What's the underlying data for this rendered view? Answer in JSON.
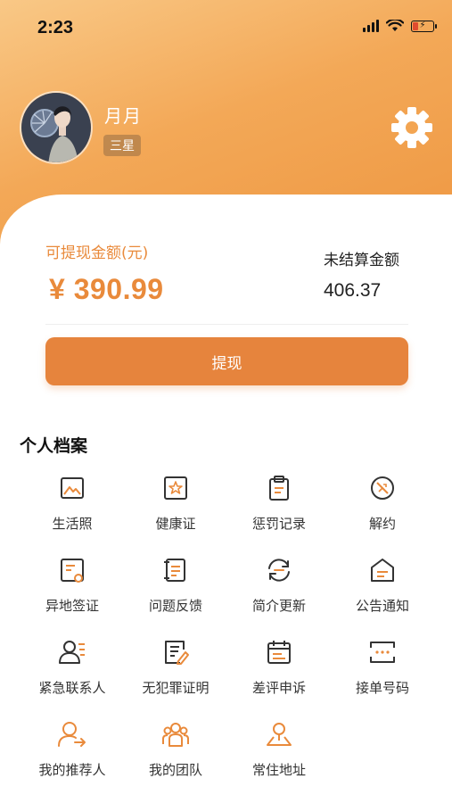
{
  "status_bar": {
    "time": "2:23"
  },
  "profile": {
    "name": "月月",
    "level": "三星"
  },
  "balance": {
    "withdrawable_label": "可提现金额(元)",
    "withdrawable_value": "¥ 390.99",
    "unsettled_label": "未结算金额",
    "unsettled_value": "406.37",
    "withdraw_button": "提现"
  },
  "section": {
    "title": "个人档案"
  },
  "grid": [
    {
      "label": "生活照",
      "icon": "photo-icon"
    },
    {
      "label": "健康证",
      "icon": "certificate-icon"
    },
    {
      "label": "惩罚记录",
      "icon": "clipboard-icon"
    },
    {
      "label": "解约",
      "icon": "cancel-contract-icon"
    },
    {
      "label": "异地签证",
      "icon": "visa-icon"
    },
    {
      "label": "问题反馈",
      "icon": "feedback-icon"
    },
    {
      "label": "简介更新",
      "icon": "refresh-icon"
    },
    {
      "label": "公告通知",
      "icon": "notice-icon"
    },
    {
      "label": "紧急联系人",
      "icon": "contact-icon"
    },
    {
      "label": "无犯罪证明",
      "icon": "document-edit-icon"
    },
    {
      "label": "差评申诉",
      "icon": "calendar-icon"
    },
    {
      "label": "接单号码",
      "icon": "phone-number-icon"
    },
    {
      "label": "我的推荐人",
      "icon": "referrer-icon"
    },
    {
      "label": "我的团队",
      "icon": "team-icon"
    },
    {
      "label": "常住地址",
      "icon": "address-icon"
    }
  ],
  "colors": {
    "accent": "#e6843d",
    "header_start": "#f9c886",
    "header_end": "#ee9640"
  }
}
